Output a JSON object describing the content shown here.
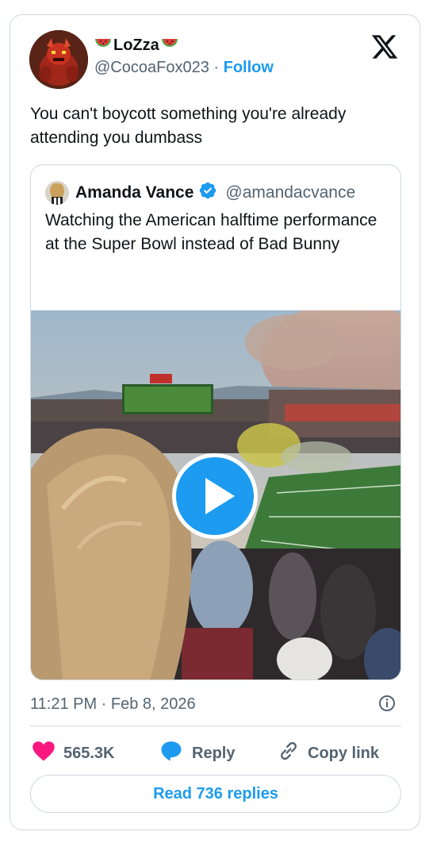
{
  "author": {
    "display_name": "LoZza",
    "handle": "@CocoaFox023",
    "separator": "·",
    "follow_label": "Follow"
  },
  "tweet": {
    "text": "You can't boycott something you're already attending you dumbass",
    "timestamp": "11:21 PM · Feb 8, 2026"
  },
  "quoted": {
    "name": "Amanda Vance",
    "handle": "@amandacvance",
    "text": "Watching the American halftime performance at the Super Bowl instead of Bad Bunny",
    "media_type": "video"
  },
  "actions": {
    "likes": "565.3K",
    "reply_label": "Reply",
    "copy_link_label": "Copy link"
  },
  "read_replies_label": "Read 736 replies",
  "colors": {
    "accent": "#1d9bf0",
    "like": "#f91880",
    "secondary_text": "#536471",
    "border": "#cfd9de"
  },
  "icons": [
    "x-logo-icon",
    "watermelon-icon",
    "verified-badge-icon",
    "play-icon",
    "info-icon",
    "heart-icon",
    "reply-bubble-icon",
    "link-icon"
  ]
}
